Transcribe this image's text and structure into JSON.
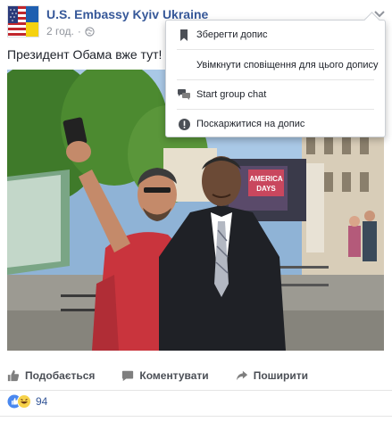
{
  "post": {
    "page_name": "U.S. Embassy Kyiv Ukraine",
    "time": "2 год.",
    "text": "Президент Обама вже тут! А",
    "photo_sign": {
      "line1": "AMERICA",
      "line2": "DAYS"
    }
  },
  "actions": {
    "like": "Подобається",
    "comment": "Коментувати",
    "share": "Поширити"
  },
  "reactions": {
    "count": "94"
  },
  "menu": {
    "items": [
      {
        "label": "Зберегти допис",
        "icon": "bookmark-icon"
      },
      {
        "label": "Увімкнути сповіщення для цього допису",
        "icon": ""
      },
      {
        "label": "Start group chat",
        "icon": "chat-icon"
      },
      {
        "label": "Поскаржитися на допис",
        "icon": "report-icon"
      }
    ]
  },
  "colors": {
    "link": "#365899",
    "muted": "#90949c",
    "action_text": "#4b4f56",
    "menu_border": "#ccd0d5"
  }
}
